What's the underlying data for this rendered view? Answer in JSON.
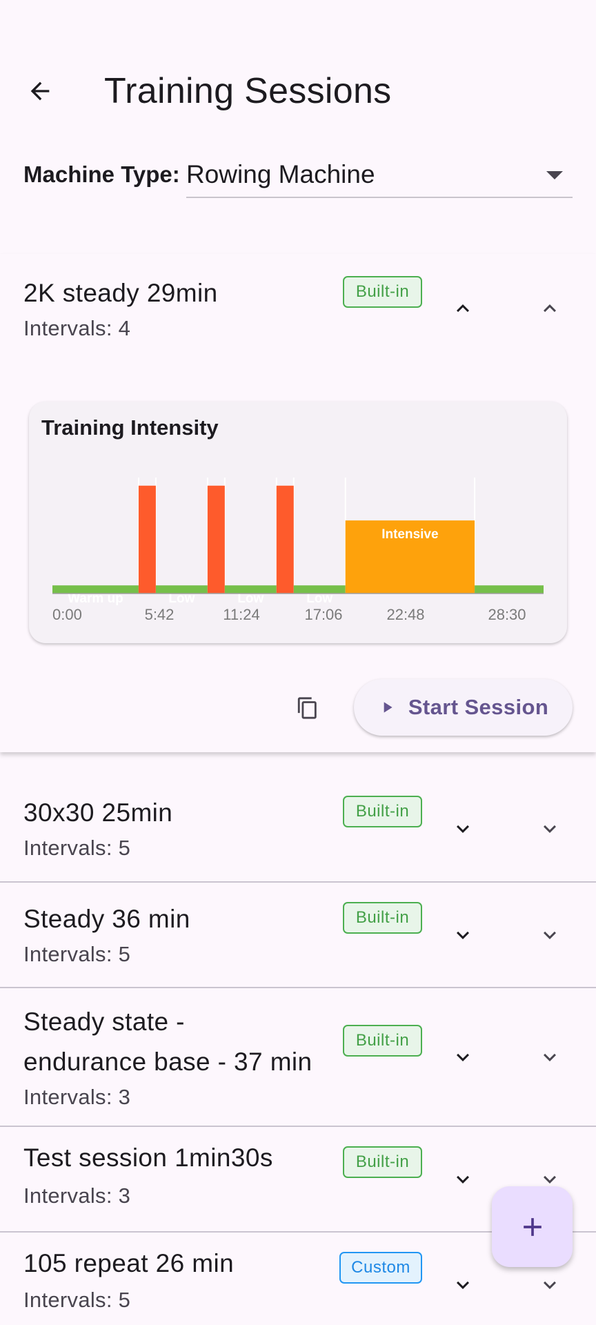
{
  "app": {
    "title": "Training Sessions"
  },
  "machine": {
    "label": "Machine Type:",
    "value": "Rowing Machine"
  },
  "expanded": {
    "title": "2K steady 29min",
    "intervals": "Intervals: 4",
    "badge": "Built-in",
    "start_label": "Start Session",
    "chart_data": {
      "type": "bar",
      "title": "Training Intensity",
      "x_ticks": [
        "0:00",
        "5:42",
        "11:24",
        "17:06",
        "22:48",
        "28:30"
      ],
      "segments": [
        {
          "label": "Warm up",
          "start": 0,
          "end": 6,
          "level": 0.07,
          "color": "#76bf4a"
        },
        {
          "label": "",
          "start": 6,
          "end": 7.2,
          "level": 0.93,
          "color": "#fe5b2c"
        },
        {
          "label": "Low",
          "start": 7.2,
          "end": 10.8,
          "level": 0.07,
          "color": "#76bf4a"
        },
        {
          "label": "",
          "start": 10.8,
          "end": 12,
          "level": 0.93,
          "color": "#fe5b2c"
        },
        {
          "label": "Low",
          "start": 12,
          "end": 15.6,
          "level": 0.07,
          "color": "#76bf4a"
        },
        {
          "label": "",
          "start": 15.6,
          "end": 16.8,
          "level": 0.93,
          "color": "#fe5b2c"
        },
        {
          "label": "Low",
          "start": 16.8,
          "end": 20.4,
          "level": 0.07,
          "color": "#76bf4a"
        },
        {
          "label": "Intensive",
          "start": 20.4,
          "end": 29.4,
          "level": 0.63,
          "color": "#fea20c"
        },
        {
          "label": "",
          "start": 29.4,
          "end": 34.2,
          "level": 0.07,
          "color": "#76bf4a"
        }
      ],
      "x_range": [
        0,
        34.2
      ]
    }
  },
  "sessions": [
    {
      "title": "30x30 25min",
      "intervals": "Intervals: 5",
      "badge": "Built-in"
    },
    {
      "title": "Steady 36 min",
      "intervals": "Intervals: 5",
      "badge": "Built-in"
    },
    {
      "title_line1": "Steady state -",
      "title_line2": "endurance base - 37 min",
      "intervals": "Intervals: 3",
      "badge": "Built-in"
    },
    {
      "title": "Test session 1min30s",
      "intervals": "Intervals: 3",
      "badge": "Built-in"
    },
    {
      "title": "105 repeat 26 min",
      "intervals": "Intervals: 5",
      "badge": "Custom"
    }
  ],
  "icons": {
    "back": "arrow-back-icon",
    "dropdown": "dropdown-arrow-icon",
    "expand": "chevron-down-icon",
    "collapse": "chevron-up-icon",
    "copy": "copy-icon",
    "play": "play-icon",
    "add": "add-icon"
  }
}
